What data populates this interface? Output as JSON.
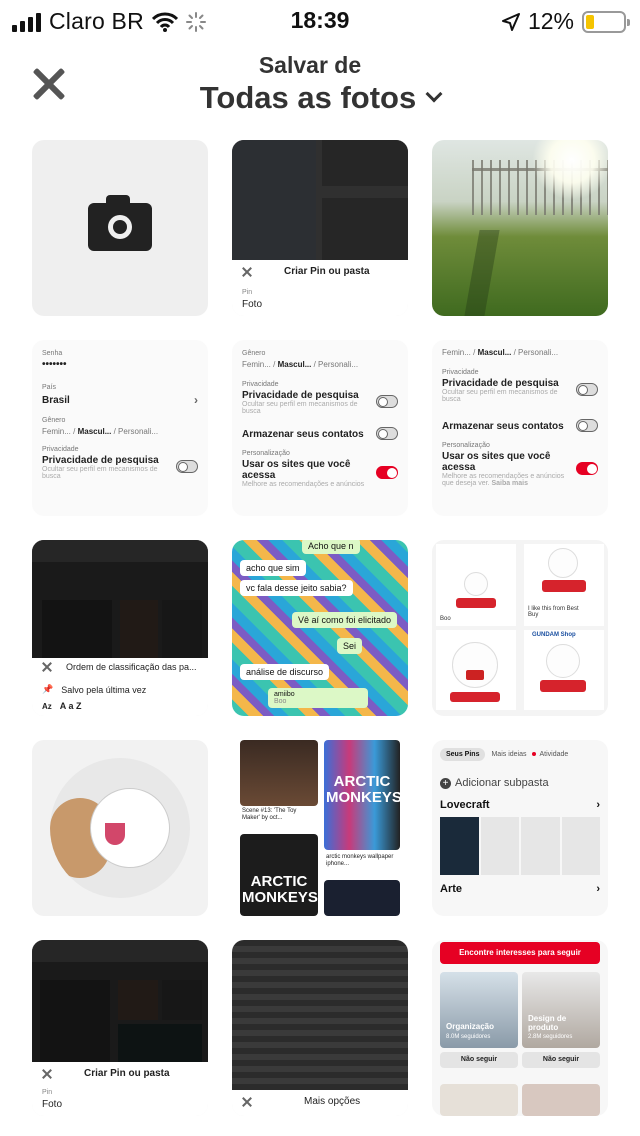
{
  "status_bar": {
    "carrier": "Claro BR",
    "time": "18:39",
    "battery": "12%"
  },
  "header": {
    "subtitle": "Salvar de",
    "title": "Todas as fotos"
  },
  "tiles": {
    "pin_sheet": {
      "header": "Criar Pin ou pasta",
      "field_label": "Pin",
      "field_value": "Foto"
    },
    "settings1": {
      "senha_label": "Senha",
      "senha_value": "•••••••",
      "pais_label": "País",
      "pais_value": "Brasil",
      "genero_label": "Gênero",
      "genero_1": "Femin...",
      "genero_2": "Mascul...",
      "genero_3": "Personali...",
      "priv_label": "Privacidade",
      "priv_value": "Privacidade de pesquisa",
      "priv_desc": "Ocultar seu perfil em mecanismos de busca"
    },
    "settings2": {
      "genero_label": "Gênero",
      "genero_1": "Femin...",
      "genero_2": "Mascul...",
      "genero_3": "Personali...",
      "priv_label": "Privacidade",
      "priv_value": "Privacidade de pesquisa",
      "priv_desc": "Ocultar seu perfil em mecanismos de busca",
      "contacts": "Armazenar seus contatos",
      "pers_label": "Personalização",
      "pers_value": "Usar os sites que você acessa",
      "pers_desc": "Melhore as recomendações e anúncios"
    },
    "settings3": {
      "genero_1": "Femin...",
      "genero_2": "Mascul...",
      "genero_3": "Personali...",
      "priv_label": "Privacidade",
      "priv_value": "Privacidade de pesquisa",
      "priv_desc": "Ocultar seu perfil em mecanismos de busca",
      "contacts": "Armazenar seus contatos",
      "pers_label": "Personalização",
      "pers_value": "Usar os sites que você acessa",
      "pers_desc": "Melhore as recomendações e anúncios que deseja ver.",
      "pers_more": "Saiba mais"
    },
    "sort_sheet": {
      "header": "Ordem de classificação das pa...",
      "option1": "Salvo pela última vez",
      "option2": "A a Z"
    },
    "chat": {
      "m1": "Acho que n",
      "m2": "acho que sim",
      "m3": "vc fala desse jeito sabia?",
      "m4": "Vê aí como foi elicitado",
      "m5": "Sei",
      "m6": "análise de discurso",
      "m7": "amiibo",
      "m8": "Boo"
    },
    "shop": {
      "cap1": "Boo",
      "cap2": "I like this from Best Buy",
      "brand": "GUNDAM Shop"
    },
    "pins": {
      "cap1": "Scene #13: 'The Toy Maker' by oct...",
      "am1": "ARCTIC MONKEYS",
      "cap2": "arctic monkeys wallpaper iphone...",
      "am2": "ARCTIC MONKEYS"
    },
    "board": {
      "tab1": "Seus Pins",
      "tab2": "Mais ideias",
      "tab3": "Atividade",
      "add": "Adicionar subpasta",
      "board1": "Lovecraft",
      "board2": "Arte"
    },
    "pin_sheet2": {
      "header": "Criar Pin ou pasta",
      "field_label": "Pin",
      "field_value": "Foto"
    },
    "more_sheet": {
      "header": "Mais opções"
    },
    "interests": {
      "banner": "Encontre interesses para seguir",
      "card1": "Organização",
      "card1_count": "8.0M seguidores",
      "card2": "Design de produto",
      "card2_count": "2.8M seguidores",
      "btn": "Não seguir"
    }
  },
  "colors": {
    "accent": "#e60023",
    "battery": "#f5c400"
  }
}
